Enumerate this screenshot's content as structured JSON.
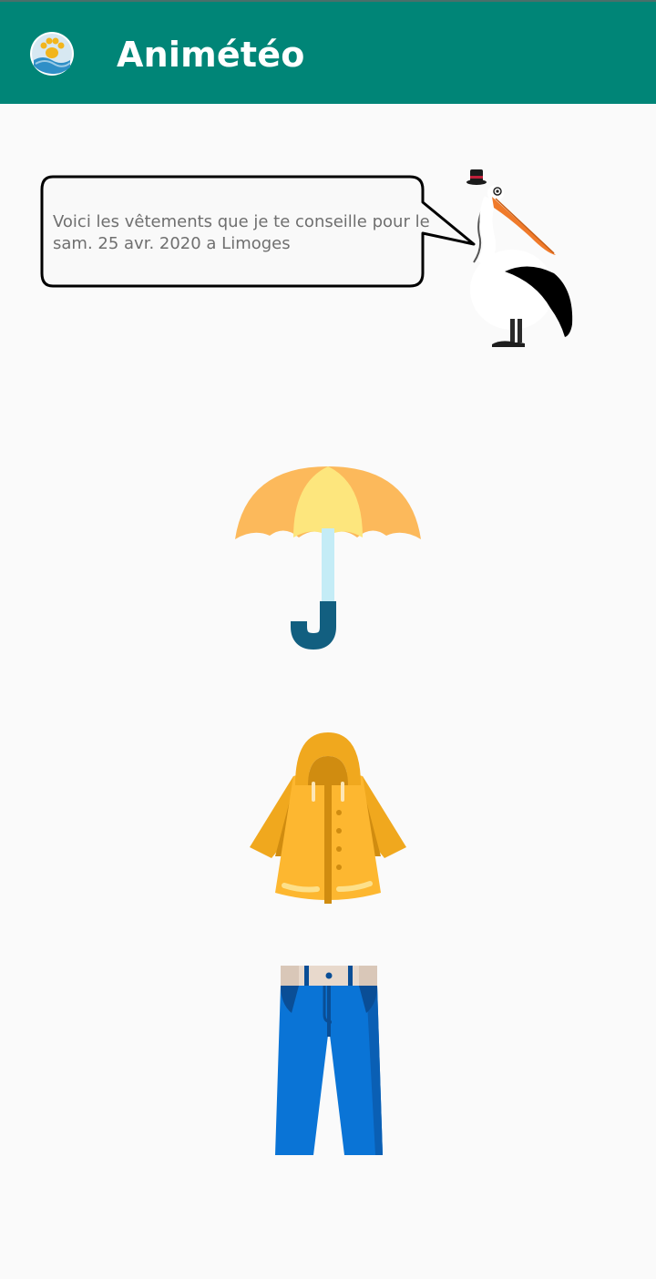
{
  "app": {
    "title": "Animétéo",
    "icon": "paw-weather-icon"
  },
  "mascot": {
    "name": "pelican-mascot",
    "message": "Voici les vêtements que je te conseille pour le sam. 25 avr. 2020 a Limoges"
  },
  "clothing": [
    {
      "name": "umbrella",
      "icon": "umbrella-icon"
    },
    {
      "name": "raincoat",
      "icon": "raincoat-icon"
    },
    {
      "name": "jeans",
      "icon": "jeans-icon"
    }
  ],
  "colors": {
    "appbar": "#008577",
    "background": "#fafafa",
    "bubble_text": "#6f6f6f"
  }
}
